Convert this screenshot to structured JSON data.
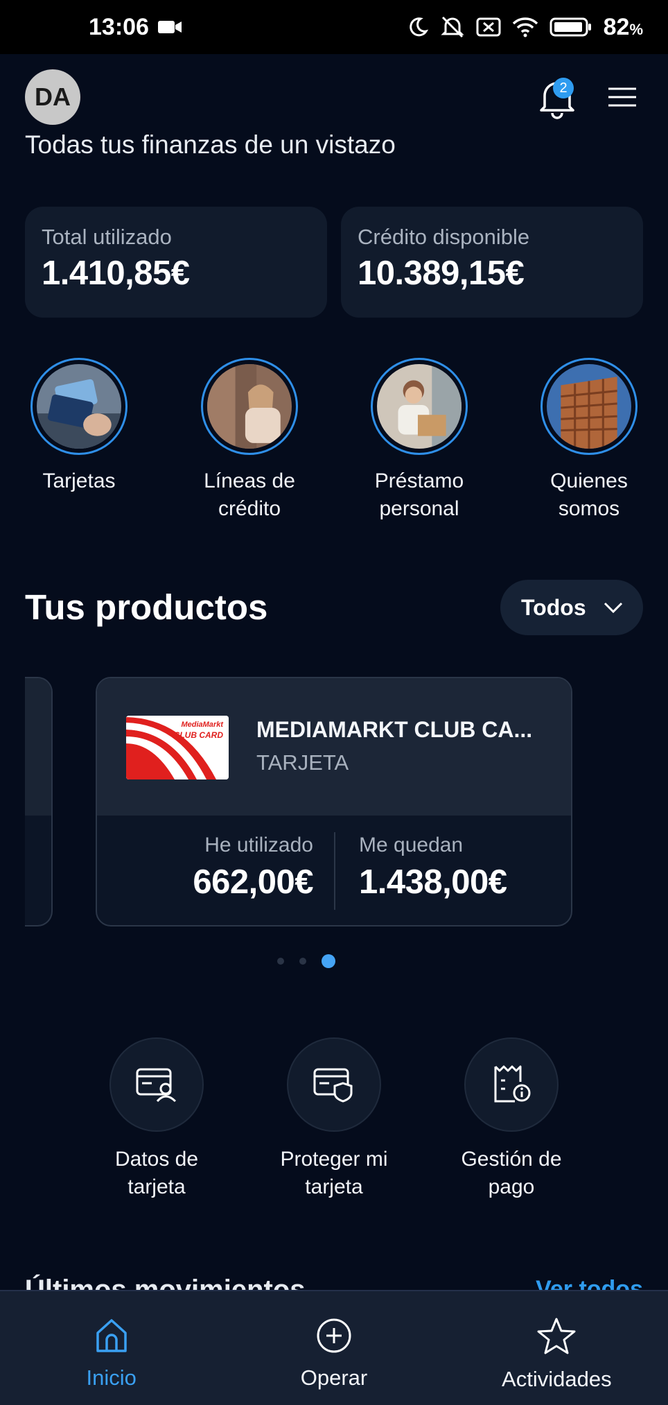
{
  "status_bar": {
    "time": "13:06",
    "battery": "82",
    "battery_unit": "%"
  },
  "header": {
    "avatar_initials": "DA",
    "notification_count": "2",
    "subtitle": "Todas tus finanzas de un vistazo"
  },
  "summary": {
    "used_label": "Total utilizado",
    "used_value": "1.410,85€",
    "available_label": "Crédito disponible",
    "available_value": "10.389,15€"
  },
  "quick_links": [
    {
      "label_line1": "Tarjetas",
      "label_line2": ""
    },
    {
      "label_line1": "Líneas de",
      "label_line2": "crédito"
    },
    {
      "label_line1": "Préstamo",
      "label_line2": "personal"
    },
    {
      "label_line1": "Quienes",
      "label_line2": "somos"
    }
  ],
  "products": {
    "title": "Tus productos",
    "filter_label": "Todos",
    "card": {
      "name": "MEDIAMARKT CLUB CA...",
      "type": "TARJETA",
      "logo_text_top": "MediaMarkt",
      "logo_text_bottom": "CLUB CARD",
      "used_label": "He utilizado",
      "used_value": "662,00€",
      "left_label": "Me quedan",
      "left_value": "1.438,00€"
    },
    "carousel_active_index": 2,
    "carousel_count": 3
  },
  "actions": [
    {
      "label_line1": "Datos de",
      "label_line2": "tarjeta",
      "icon": "card-user-icon"
    },
    {
      "label_line1": "Proteger mi",
      "label_line2": "tarjeta",
      "icon": "card-shield-icon"
    },
    {
      "label_line1": "Gestión de",
      "label_line2": "pago",
      "icon": "receipt-info-icon"
    }
  ],
  "movements": {
    "title": "Últimos movimientos",
    "link": "Ver todos"
  },
  "bottom_nav": [
    {
      "label": "Inicio",
      "icon": "home-icon",
      "active": true
    },
    {
      "label": "Operar",
      "icon": "plus-circle-icon",
      "active": false
    },
    {
      "label": "Actividades",
      "icon": "star-icon",
      "active": false
    }
  ],
  "colors": {
    "background": "#050c1c",
    "card": "#111b2c",
    "accent": "#2f9cf0"
  }
}
